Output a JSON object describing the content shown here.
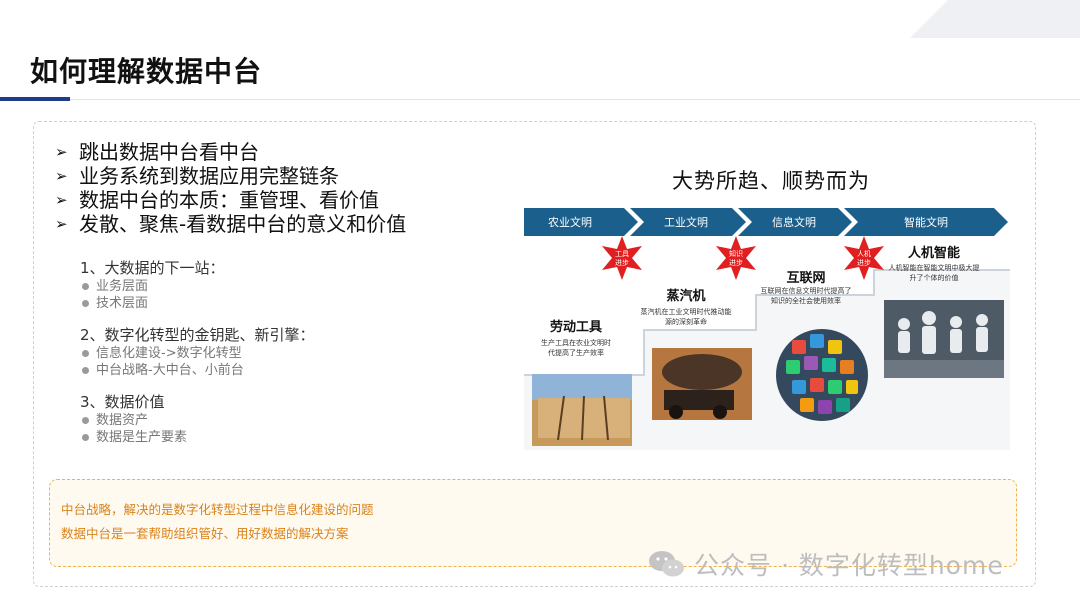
{
  "title": "如何理解数据中台",
  "bullets": [
    "跳出数据中台看中台",
    "业务系统到数据应用完整链条",
    "数据中台的本质：重管理、看价值",
    "发散、聚焦-看数据中台的意义和价值"
  ],
  "sections": [
    {
      "heading": "1、大数据的下一站：",
      "items": [
        "业务层面",
        "技术层面"
      ]
    },
    {
      "heading": "2、数字化转型的金钥匙、新引擎：",
      "items": [
        "信息化建设->数字化转型",
        "中台战略-大中台、小前台"
      ]
    },
    {
      "heading": "3、数据价值",
      "items": [
        "数据资产",
        "数据是生产要素"
      ]
    }
  ],
  "diagram": {
    "title": "大势所趋、顺势而为",
    "eras": [
      "农业文明",
      "工业文明",
      "信息文明",
      "智能文明"
    ],
    "badges": [
      [
        "工具",
        "进步"
      ],
      [
        "知识",
        "进步"
      ],
      [
        "人机",
        "进步"
      ]
    ],
    "stages": [
      {
        "name": "劳动工具",
        "desc": [
          "生产工具在农业文明时",
          "代提高了生产效率"
        ]
      },
      {
        "name": "蒸汽机",
        "desc": [
          "蒸汽机在工业文明时代推动能",
          "源的深刻革命"
        ]
      },
      {
        "name": "互联网",
        "desc": [
          "互联网在信息文明时代提高了",
          "知识的全社会使用效率"
        ]
      },
      {
        "name": "人机智能",
        "desc": [
          "人机智能在智能文明中极大提",
          "升了个体的价值"
        ]
      }
    ]
  },
  "callout": [
    "中台战略，解决的是数字化转型过程中信息化建设的问题",
    "数据中台是一套帮助组织管好、用好数据的解决方案"
  ],
  "watermark": "公众号 · 数字化转型home",
  "colors": {
    "accent": "#1f3c88",
    "chevron": "#1b5f8c",
    "badge": "#e02020",
    "callout_text": "#d9821a",
    "callout_border": "#f2b248"
  }
}
